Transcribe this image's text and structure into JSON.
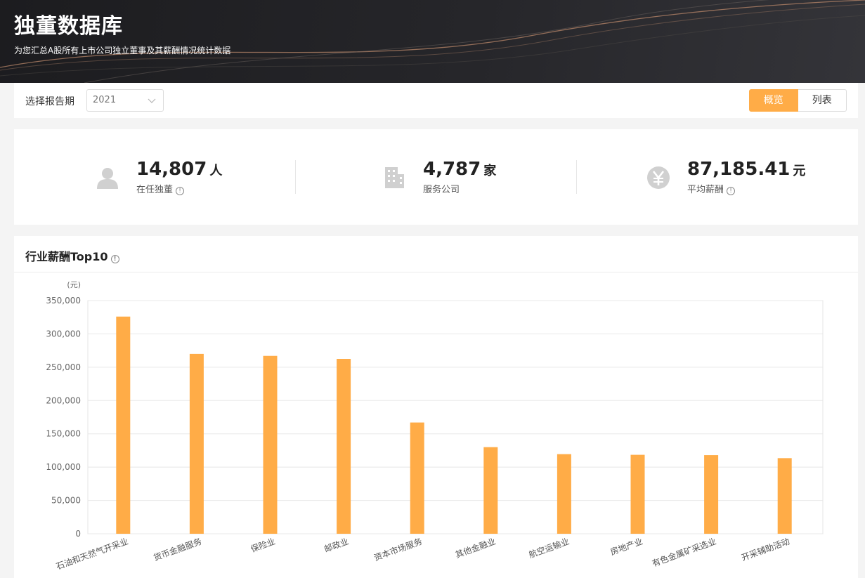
{
  "header": {
    "title": "独董数据库",
    "subtitle": "为您汇总A股所有上市公司独立董事及其薪酬情况统计数据"
  },
  "toolbar": {
    "period_label": "选择报告期",
    "period_value": "2021",
    "view_overview": "概览",
    "view_list": "列表"
  },
  "stats": [
    {
      "value": "14,807",
      "unit": "人",
      "label": "在任独董",
      "icon": "user-icon"
    },
    {
      "value": "4,787",
      "unit": "家",
      "label": "服务公司",
      "icon": "building-icon"
    },
    {
      "value": "87,185.41",
      "unit": "元",
      "label": "平均薪酬",
      "icon": "yen-icon"
    }
  ],
  "panel": {
    "title": "行业薪酬Top10"
  },
  "colors": {
    "accent": "#ffac47",
    "header_bg": "#1f1f22"
  },
  "chart_data": {
    "type": "bar",
    "ylabel": "(元)",
    "ylim": [
      0,
      350000
    ],
    "yticks": [
      0,
      50000,
      100000,
      150000,
      200000,
      250000,
      300000,
      350000
    ],
    "ytick_labels": [
      "0",
      "50,000",
      "100,000",
      "150,000",
      "200,000",
      "250,000",
      "300,000",
      "350,000"
    ],
    "categories": [
      "石油和天然气开采业",
      "货币金融服务",
      "保险业",
      "邮政业",
      "资本市场服务",
      "其他金融业",
      "航空运输业",
      "房地产业",
      "有色金属矿采选业",
      "开采辅助活动"
    ],
    "values": [
      326000,
      270000,
      267000,
      262500,
      167000,
      130000,
      119500,
      118500,
      118000,
      113500
    ],
    "grid": true
  }
}
